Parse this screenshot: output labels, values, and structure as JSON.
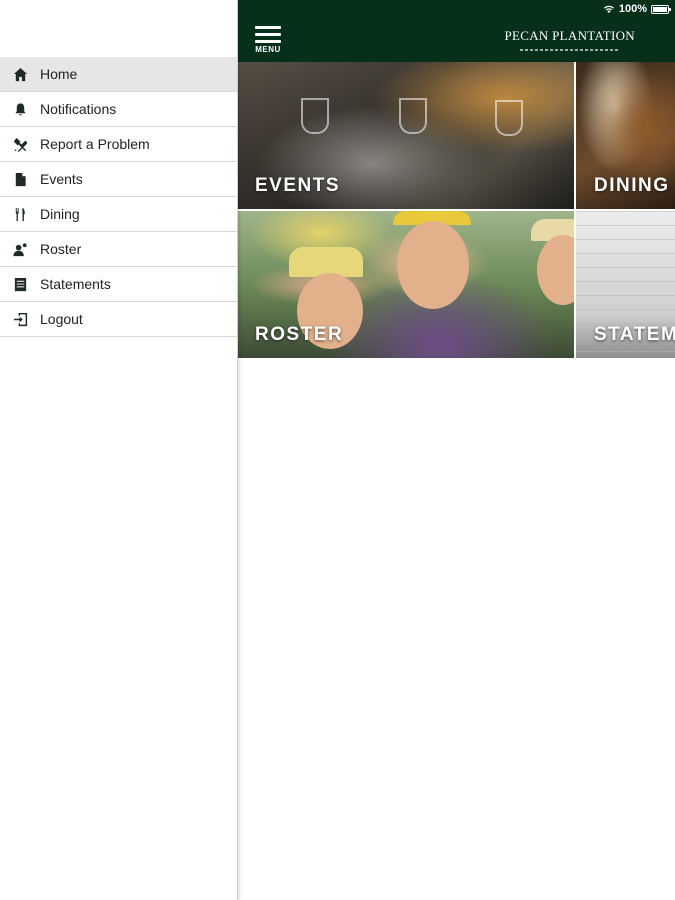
{
  "status": {
    "battery": "100%"
  },
  "drawer": {
    "items": [
      {
        "label": "Home",
        "icon": "home-icon",
        "active": true
      },
      {
        "label": "Notifications",
        "icon": "bell-icon"
      },
      {
        "label": "Report a Problem",
        "icon": "tools-icon"
      },
      {
        "label": "Events",
        "icon": "document-icon"
      },
      {
        "label": "Dining",
        "icon": "utensils-icon"
      },
      {
        "label": "Roster",
        "icon": "people-icon"
      },
      {
        "label": "Statements",
        "icon": "statement-icon"
      },
      {
        "label": "Logout",
        "icon": "logout-icon"
      }
    ]
  },
  "header": {
    "menu_label": "MENU",
    "logo_text": "PECAN PLANTATION",
    "background": "#06301a"
  },
  "tiles": [
    {
      "label": "EVENTS"
    },
    {
      "label": "DINING"
    },
    {
      "label": "ROSTER"
    },
    {
      "label": "STATEM"
    }
  ]
}
